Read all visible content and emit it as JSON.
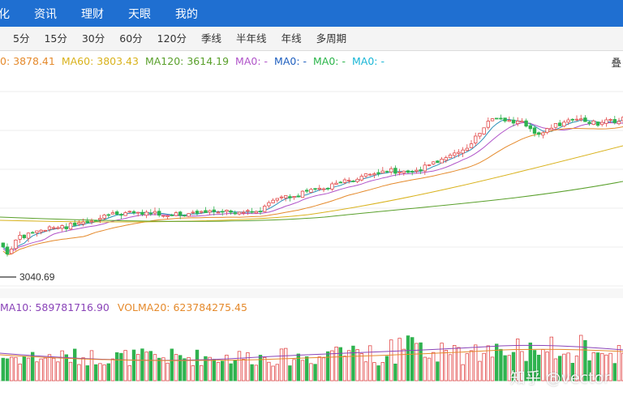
{
  "nav": {
    "items": [
      "化",
      "资讯",
      "理财",
      "天眼",
      "我的"
    ]
  },
  "periods": [
    "5分",
    "15分",
    "30分",
    "60分",
    "120分",
    "季线",
    "半年线",
    "年线",
    "多周期"
  ],
  "ma_legend": [
    {
      "label": "0: 3878.41",
      "color": "#e58a2c"
    },
    {
      "label": "MA60: 3803.43",
      "color": "#d9b21c"
    },
    {
      "label": "MA120: 3614.19",
      "color": "#5aa02c"
    },
    {
      "label": "MA0: -",
      "color": "#b053c9"
    },
    {
      "label": "MA0: -",
      "color": "#1f5fbf"
    },
    {
      "label": "MA0: -",
      "color": "#2bb54a"
    },
    {
      "label": "MA0: -",
      "color": "#19b6d6"
    }
  ],
  "overlay_label": "叠",
  "low_price_label": "3040.69",
  "vol_legend": [
    {
      "label": "MA10:  589781716.90",
      "color": "#8a44b8"
    },
    {
      "label": "VOLMA20:  623784275.45",
      "color": "#e58a2c"
    }
  ],
  "watermark": "知乎 @vector",
  "colors": {
    "up": "#e24a4a",
    "down": "#2fb34f",
    "nav_bg": "#1f6fd1"
  }
}
